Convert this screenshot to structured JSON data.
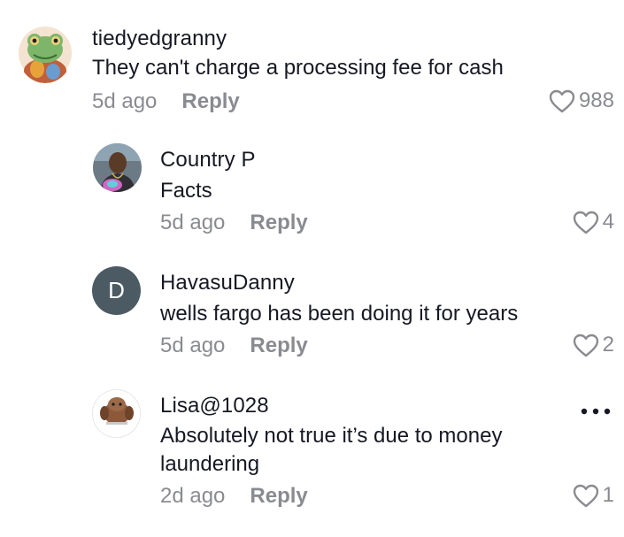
{
  "comments": [
    {
      "username": "tiedyedgranny",
      "text": "They can't charge a processing fee for cash",
      "time": "5d ago",
      "reply": "Reply",
      "likes": "988",
      "avatar_icon": "frog-avatar"
    },
    {
      "username": "Country P",
      "text": "Facts",
      "time": "5d ago",
      "reply": "Reply",
      "likes": "4",
      "avatar_icon": "person-photo-avatar"
    },
    {
      "username": "HavasuDanny",
      "text": "wells fargo has been doing it for years",
      "time": "5d ago",
      "reply": "Reply",
      "likes": "2",
      "avatar_letter": "D",
      "avatar_color": "#4c5a64"
    },
    {
      "username": "Lisa@1028",
      "text_line1": "Absolutely not true it’s due to money",
      "text_line2": "laundering",
      "time": "2d ago",
      "reply": "Reply",
      "likes": "1",
      "avatar_icon": "dog-photo-avatar",
      "more_icon": "more-options-icon"
    }
  ],
  "colors": {
    "text": "#161823",
    "muted": "#8a8b91"
  }
}
